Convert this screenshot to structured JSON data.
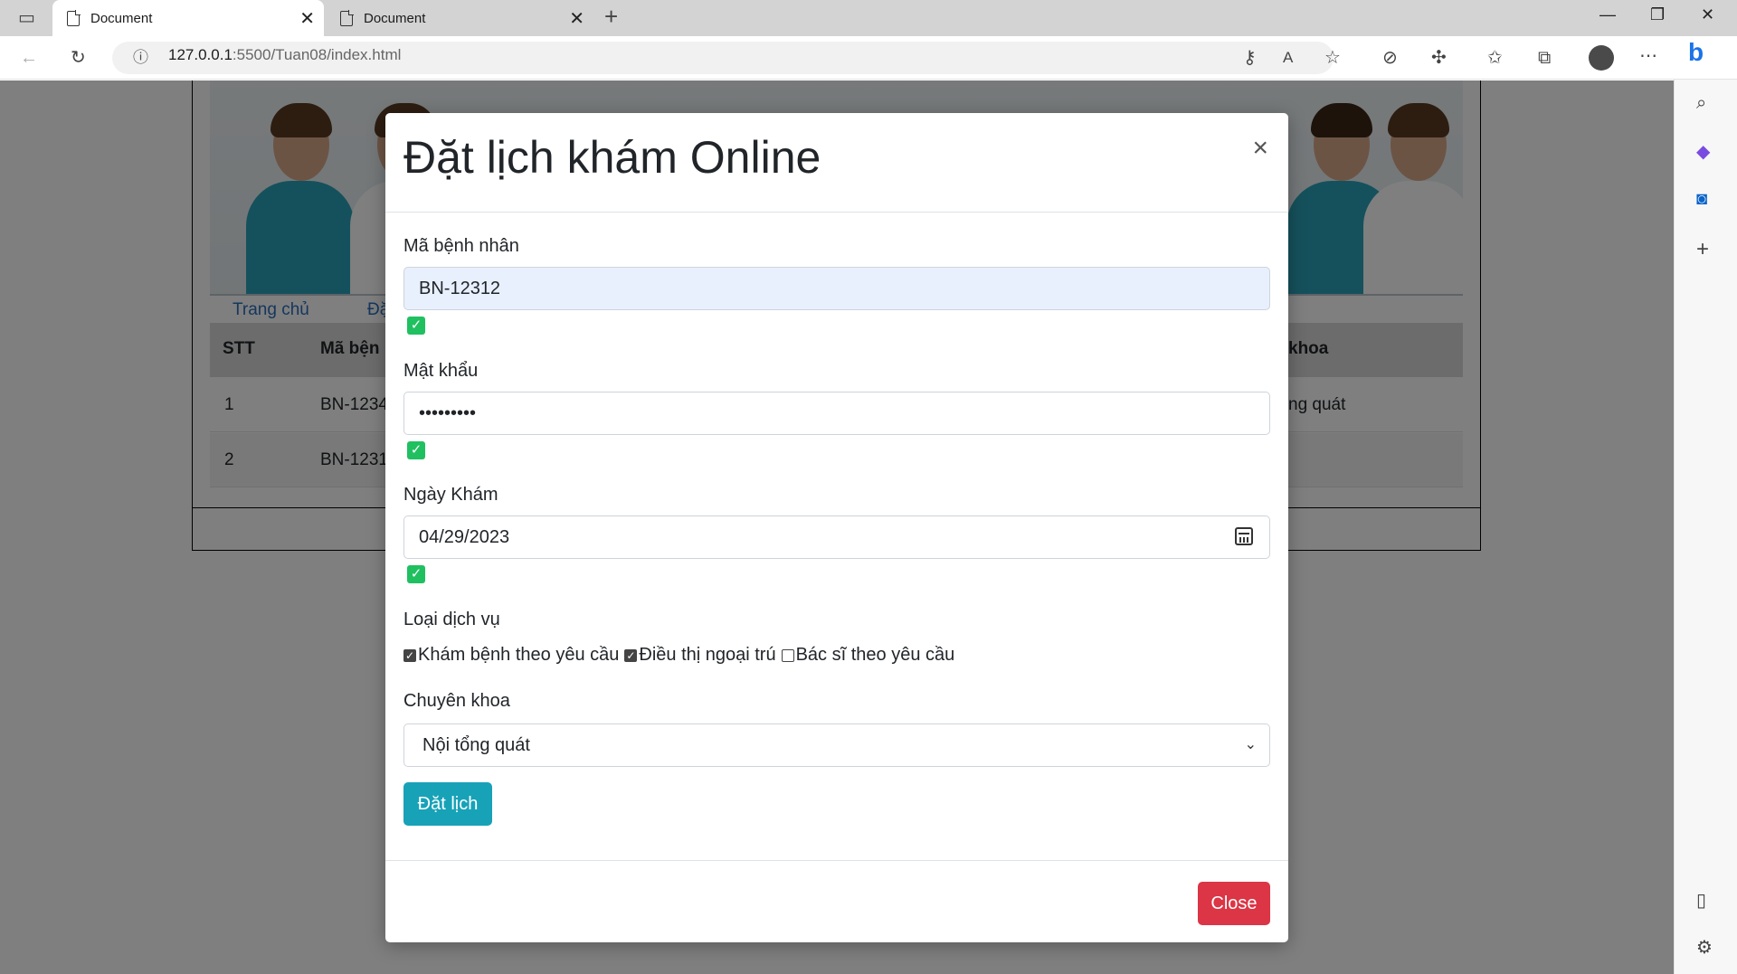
{
  "browser": {
    "tabs": [
      {
        "title": "Document",
        "active": true
      },
      {
        "title": "Document",
        "active": false
      }
    ],
    "url_host": "127.0.0.1",
    "url_rest": ":5500/Tuan08/index.html"
  },
  "page": {
    "nav": [
      "Trang chủ",
      "Đặ"
    ],
    "table": {
      "headers": [
        "STT",
        "Mã bện",
        "khoa"
      ],
      "rows": [
        {
          "stt": "1",
          "ma": "BN-1234",
          "khoa": "ng quát"
        },
        {
          "stt": "2",
          "ma": "BN-1231",
          "khoa": ""
        }
      ]
    }
  },
  "modal": {
    "title": "Đặt lịch khám Online",
    "patient_id_label": "Mã bệnh nhân",
    "patient_id_value": "BN-12312",
    "password_label": "Mật khẩu",
    "password_value": "•••••••••",
    "date_label": "Ngày Khám",
    "date_value": "04/29/2023",
    "service_label": "Loại dịch vụ",
    "services": [
      {
        "label": "Khám bệnh theo yêu cầu",
        "checked": true
      },
      {
        "label": "Điều thị ngoại trú",
        "checked": true
      },
      {
        "label": "Bác sĩ theo yêu cầu",
        "checked": false
      }
    ],
    "specialty_label": "Chuyên khoa",
    "specialty_value": "Nội tổng quát",
    "submit_label": "Đặt lịch",
    "close_label": "Close",
    "close_x": "×"
  },
  "colors": {
    "submit": "#17a2b8",
    "close": "#dc3545",
    "valid": "#20c060"
  }
}
